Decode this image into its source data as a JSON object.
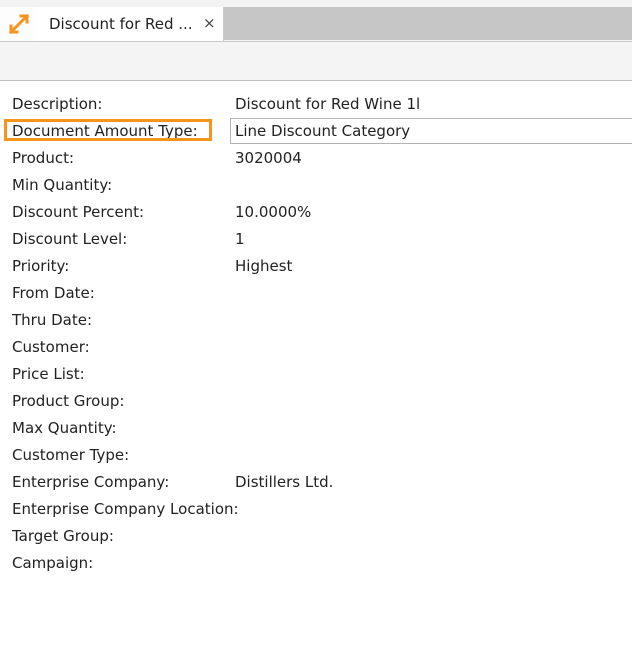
{
  "tab": {
    "title": "Discount for Red ...",
    "close_glyph": "×"
  },
  "icons": {
    "app": "resize-arrows-icon",
    "close": "close-icon"
  },
  "colors": {
    "app_icon": "#f7941d",
    "highlight": "#f7941d"
  },
  "form": {
    "fields": [
      {
        "label": "Description:",
        "value": "Discount for Red Wine 1l"
      },
      {
        "label": "Document Amount Type:",
        "value": "Line Discount Category"
      },
      {
        "label": "Product:",
        "value": "3020004"
      },
      {
        "label": "Min Quantity:",
        "value": ""
      },
      {
        "label": "Discount Percent:",
        "value": "10.0000%"
      },
      {
        "label": "Discount Level:",
        "value": "1"
      },
      {
        "label": "Priority:",
        "value": "Highest"
      },
      {
        "label": "From Date:",
        "value": ""
      },
      {
        "label": "Thru Date:",
        "value": ""
      },
      {
        "label": "Customer:",
        "value": ""
      },
      {
        "label": "Price List:",
        "value": ""
      },
      {
        "label": "Product Group:",
        "value": ""
      },
      {
        "label": "Max Quantity:",
        "value": ""
      },
      {
        "label": "Customer Type:",
        "value": ""
      },
      {
        "label": "Enterprise Company:",
        "value": "Distillers Ltd."
      },
      {
        "label": "Enterprise Company Location:",
        "value": ""
      },
      {
        "label": "Target Group:",
        "value": ""
      },
      {
        "label": "Campaign:",
        "value": ""
      }
    ]
  }
}
